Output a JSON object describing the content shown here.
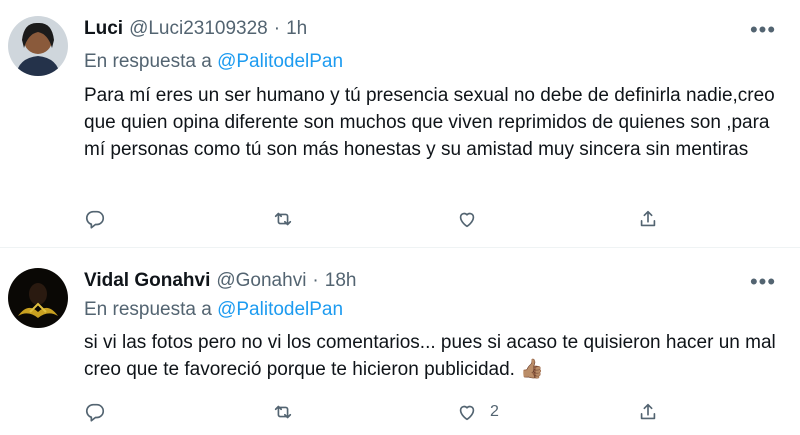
{
  "tweets": [
    {
      "name": "Luci",
      "handle": "@Luci23109328",
      "dot": "·",
      "time": "1h",
      "reply_prefix": "En respuesta a",
      "reply_handle": "@PalitodelPan",
      "text": "Para mí eres un ser humano y tú presencia sexual no debe de definirla nadie,creo que  quien opina  diferente  son muchos que viven reprimidos de quienes son  ,para mí personas como tú son más honestas  y su amistad muy sincera sin mentiras",
      "like_count": "",
      "more": "•••"
    },
    {
      "name": "Vidal Gonahvi",
      "handle": "@Gonahvi",
      "dot": "·",
      "time": "18h",
      "reply_prefix": "En respuesta a",
      "reply_handle": "@PalitodelPan",
      "text": "si vi las fotos pero no vi los comentarios... pues si acaso te quisieron hacer un mal creo que te favoreció porque te hicieron publicidad. 👍🏽",
      "like_count": "2",
      "more": "•••"
    }
  ],
  "colors": {
    "text": "#0f1419",
    "secondary": "#536471",
    "link": "#1d9bf0",
    "divider": "#eff3f4"
  },
  "icons": [
    "reply-icon",
    "retweet-icon",
    "like-icon",
    "share-icon",
    "more-icon"
  ]
}
